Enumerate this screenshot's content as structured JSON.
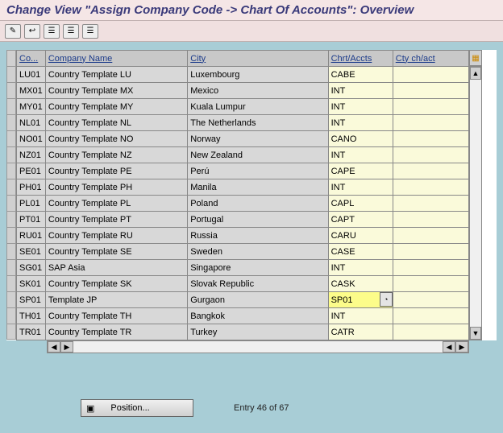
{
  "title": "Change View \"Assign Company Code -> Chart Of Accounts\": Overview",
  "toolbar": {
    "t1": "✎",
    "t2": "↩",
    "t3": "☰",
    "t4": "☰",
    "t5": "☰"
  },
  "headers": {
    "code": "Co...",
    "name": "Company Name",
    "city": "City",
    "chart": "Chrt/Accts",
    "cty": "Cty ch/act"
  },
  "rows": [
    {
      "code": "LU01",
      "name": "Country Template LU",
      "city": "Luxembourg",
      "chart": "CABE",
      "cty": ""
    },
    {
      "code": "MX01",
      "name": "Country Template MX",
      "city": "Mexico",
      "chart": "INT",
      "cty": ""
    },
    {
      "code": "MY01",
      "name": "Country Template MY",
      "city": "Kuala Lumpur",
      "chart": "INT",
      "cty": ""
    },
    {
      "code": "NL01",
      "name": "Country Template NL",
      "city": "The Netherlands",
      "chart": "INT",
      "cty": ""
    },
    {
      "code": "NO01",
      "name": "Country Template NO",
      "city": "Norway",
      "chart": "CANO",
      "cty": ""
    },
    {
      "code": "NZ01",
      "name": "Country Template NZ",
      "city": "New Zealand",
      "chart": "INT",
      "cty": ""
    },
    {
      "code": "PE01",
      "name": "Country Template PE",
      "city": "Perú",
      "chart": "CAPE",
      "cty": ""
    },
    {
      "code": "PH01",
      "name": "Country Template PH",
      "city": "Manila",
      "chart": "INT",
      "cty": ""
    },
    {
      "code": "PL01",
      "name": "Country Template PL",
      "city": "Poland",
      "chart": "CAPL",
      "cty": ""
    },
    {
      "code": "PT01",
      "name": "Country Template PT",
      "city": "Portugal",
      "chart": "CAPT",
      "cty": ""
    },
    {
      "code": "RU01",
      "name": "Country Template RU",
      "city": "Russia",
      "chart": "CARU",
      "cty": ""
    },
    {
      "code": "SE01",
      "name": "Country Template SE",
      "city": "Sweden",
      "chart": "CASE",
      "cty": ""
    },
    {
      "code": "SG01",
      "name": "SAP Asia",
      "city": "Singapore",
      "chart": "INT",
      "cty": ""
    },
    {
      "code": "SK01",
      "name": "Country Template SK",
      "city": "Slovak Republic",
      "chart": "CASK",
      "cty": ""
    },
    {
      "code": "SP01",
      "name": "Template JP",
      "city": "Gurgaon",
      "chart": "SP01",
      "cty": ""
    },
    {
      "code": "TH01",
      "name": "Country Template TH",
      "city": "Bangkok",
      "chart": "INT",
      "cty": ""
    },
    {
      "code": "TR01",
      "name": "Country Template TR",
      "city": "Turkey",
      "chart": "CATR",
      "cty": ""
    }
  ],
  "active_row": 14,
  "footer": {
    "position": "Position...",
    "entry": "Entry 46 of 67"
  }
}
